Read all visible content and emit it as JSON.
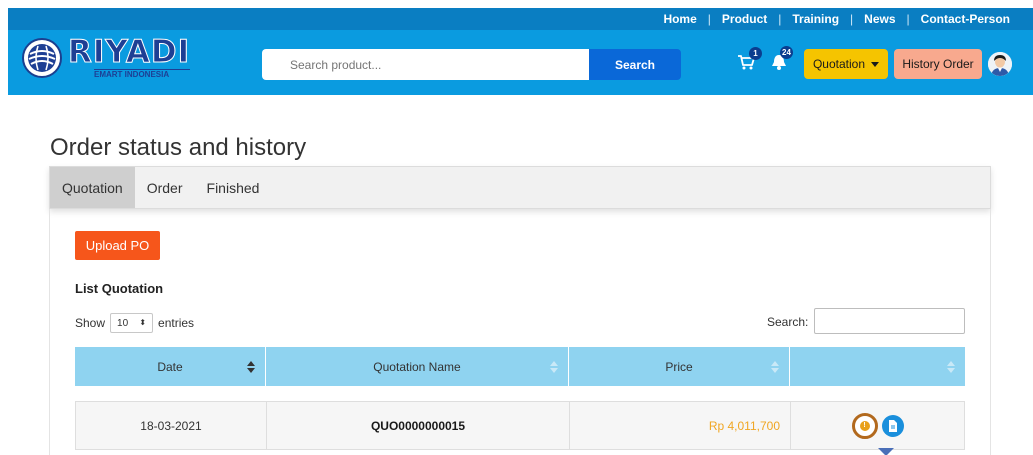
{
  "topnav": {
    "items": [
      "Home",
      "Product",
      "Training",
      "News",
      "Contact-Person"
    ],
    "separator": "|"
  },
  "brand": {
    "name": "RIYADI",
    "subtitle": "EMART INDONESIA",
    "color": "#1e3f94"
  },
  "search": {
    "placeholder": "Search product...",
    "button_label": "Search"
  },
  "cart": {
    "count": "1"
  },
  "notifications": {
    "count": "24"
  },
  "quotation_menu": {
    "label": "Quotation"
  },
  "history_button": {
    "label": "History Order"
  },
  "page": {
    "title": "Order status and history"
  },
  "tabs": [
    {
      "label": "Quotation",
      "active": true
    },
    {
      "label": "Order",
      "active": false
    },
    {
      "label": "Finished",
      "active": false
    }
  ],
  "upload_button": {
    "label": "Upload PO"
  },
  "list": {
    "title": "List Quotation",
    "show_label": "Show",
    "entries_value": "10",
    "entries_label": "entries",
    "search_label": "Search:"
  },
  "table": {
    "columns": [
      "Date",
      "Quotation Name",
      "Price",
      ""
    ],
    "rows": [
      {
        "date": "18-03-2021",
        "name": "QUO0000000015",
        "price": "Rp 4,011,700"
      }
    ]
  },
  "colors": {
    "header": "#0a9be0",
    "topbar": "#0a7ec2",
    "search_button": "#0a68d8",
    "quotation_button": "#f5c400",
    "history_button": "#f8a98e",
    "upload_button": "#f6561b",
    "table_header": "#8fd3f0",
    "price_text": "#f0a623"
  }
}
